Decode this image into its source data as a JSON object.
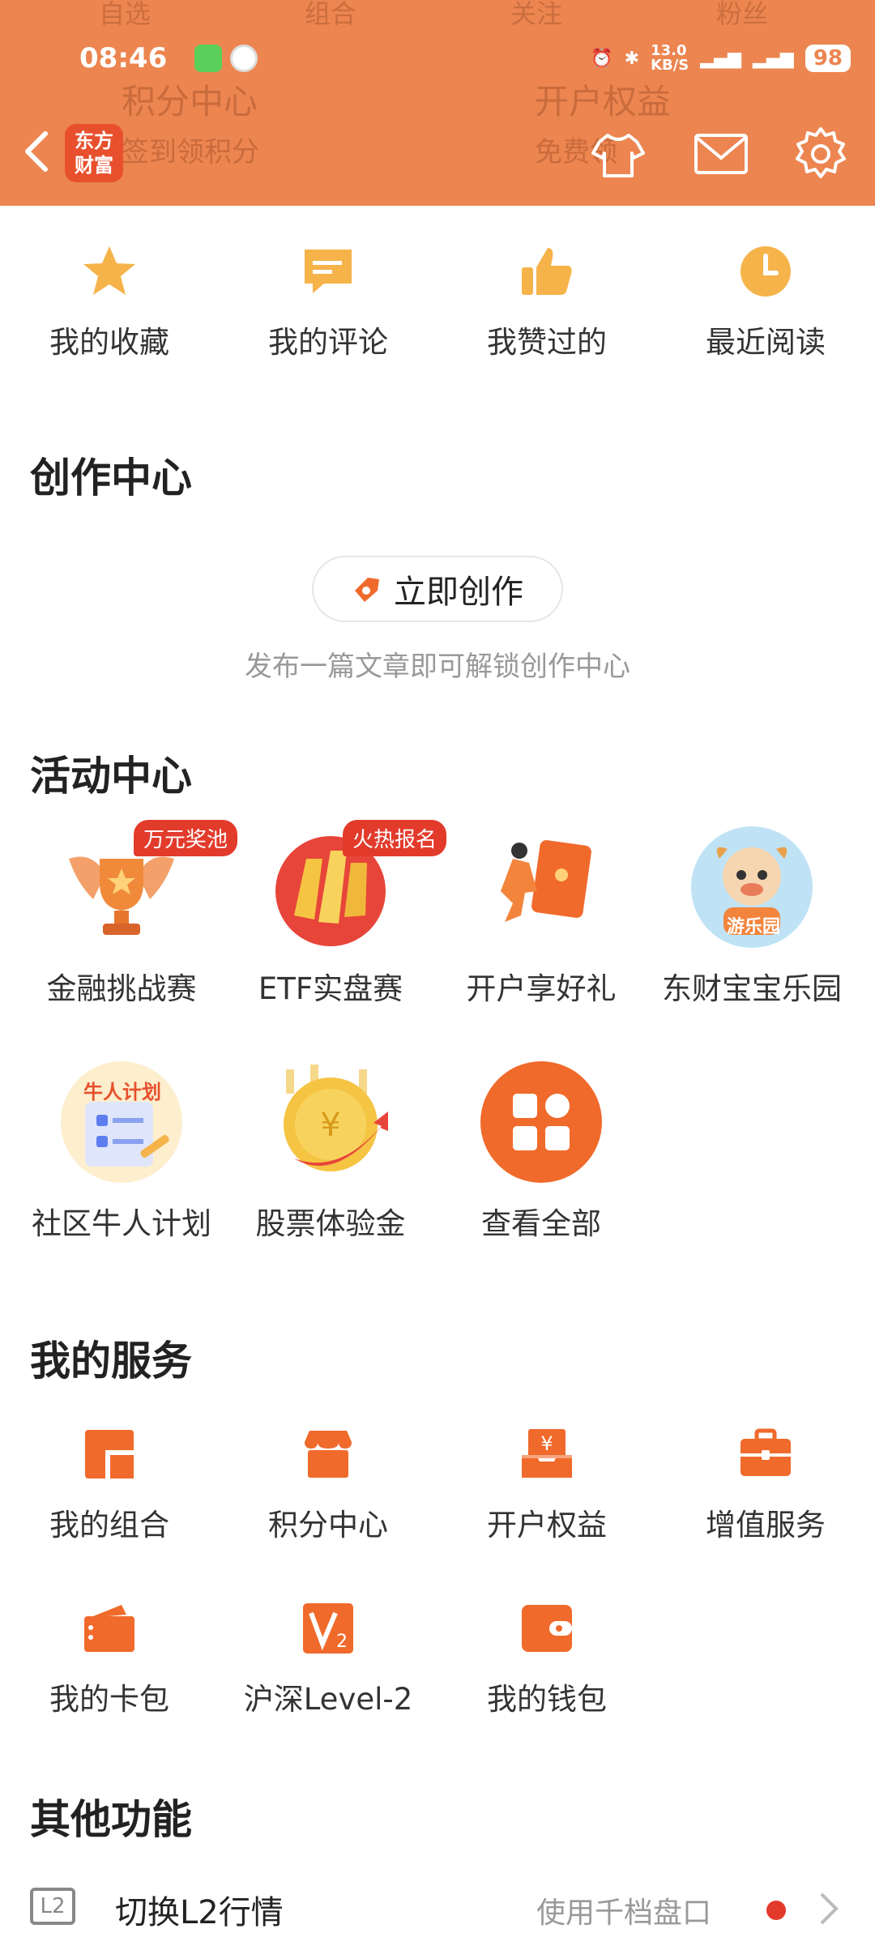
{
  "status_bar": {
    "time": "08:46",
    "net_speed": "13.0\nKB/S",
    "battery": "98"
  },
  "header_bg_tabs": [
    "自选",
    "组合",
    "关注",
    "粉丝"
  ],
  "header_bg_cards": [
    {
      "title": "积分中心",
      "sub": "签到领积分"
    },
    {
      "title": "开户权益",
      "sub": "免费领"
    }
  ],
  "nav": {
    "logo_text": "东方\n财富"
  },
  "quick": [
    {
      "label": "我的收藏",
      "icon": "star-icon"
    },
    {
      "label": "我的评论",
      "icon": "comment-icon"
    },
    {
      "label": "我赞过的",
      "icon": "thumbs-up-icon"
    },
    {
      "label": "最近阅读",
      "icon": "clock-icon"
    }
  ],
  "creation": {
    "title": "创作中心",
    "button": "立即创作",
    "hint": "发布一篇文章即可解锁创作中心"
  },
  "activity": {
    "title": "活动中心",
    "items": [
      {
        "label": "金融挑战赛",
        "badge": "万元奖池"
      },
      {
        "label": "ETF实盘赛",
        "badge": "火热报名"
      },
      {
        "label": "开户享好礼",
        "badge": ""
      },
      {
        "label": "东财宝宝乐园",
        "badge": "",
        "pic_text": "游乐园"
      },
      {
        "label": "社区牛人计划",
        "badge": "",
        "pic_text": "牛人计划"
      },
      {
        "label": "股票体验金",
        "badge": ""
      },
      {
        "label": "查看全部",
        "badge": ""
      }
    ]
  },
  "services": {
    "title": "我的服务",
    "items": [
      {
        "label": "我的组合"
      },
      {
        "label": "积分中心"
      },
      {
        "label": "开户权益"
      },
      {
        "label": "增值服务"
      },
      {
        "label": "我的卡包"
      },
      {
        "label": "沪深Level-2"
      },
      {
        "label": "我的钱包"
      }
    ]
  },
  "other": {
    "title": "其他功能",
    "row": {
      "icon_text": "L2",
      "label": "切换L2行情",
      "right": "使用千档盘口"
    }
  },
  "colors": {
    "accent": "#ec8550",
    "icon_orange": "#f06a2b",
    "icon_yellow": "#f5b34a",
    "badge_red": "#e23b2c"
  }
}
